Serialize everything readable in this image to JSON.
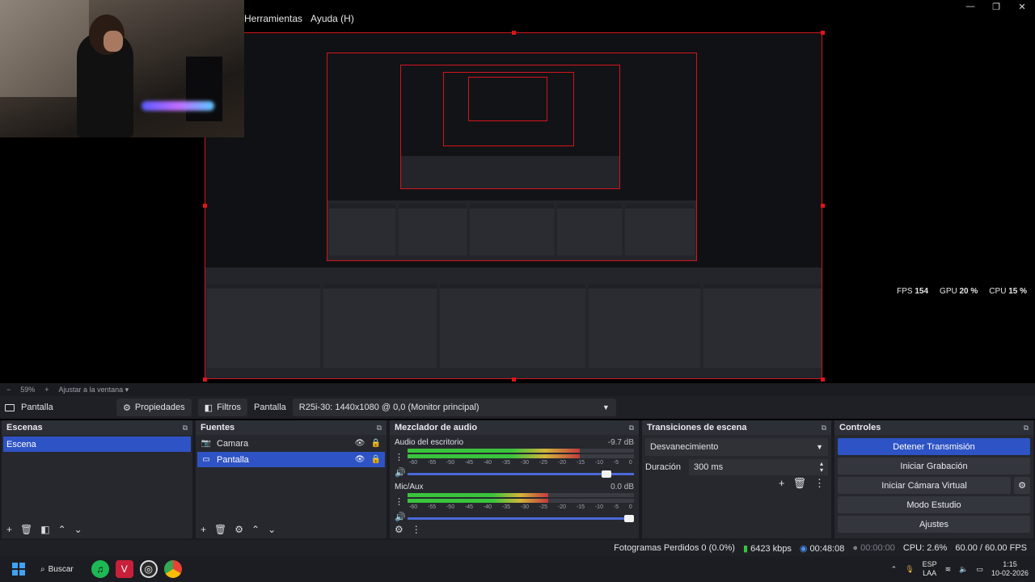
{
  "menu": {
    "tools": "Herramientas",
    "help": "Ayuda (H)"
  },
  "window_controls": [
    "—",
    "❐",
    "✕"
  ],
  "preview_stats": {
    "fps_label": "FPS",
    "fps_value": "154",
    "gpu_label": "GPU",
    "gpu_value": "20 %",
    "cpu_label": "CPU",
    "cpu_value": "15 %"
  },
  "zoom_bar": {
    "minus": "−",
    "zoom": "59%",
    "plus": "+",
    "fit": "Ajustar a la ventana"
  },
  "source_toolbar": {
    "source_name": "Pantalla",
    "properties": "Propiedades",
    "filters": "Filtros",
    "display_label": "Pantalla",
    "display_value": "R25i-30: 1440x1080 @ 0,0 (Monitor principal)"
  },
  "scenes": {
    "title": "Escenas",
    "items": [
      {
        "label": "Escena",
        "selected": true
      }
    ]
  },
  "sources": {
    "title": "Fuentes",
    "items": [
      {
        "label": "Camara",
        "icon": "camera-icon",
        "selected": false
      },
      {
        "label": "Pantalla",
        "icon": "monitor-icon",
        "selected": true
      }
    ]
  },
  "mixer": {
    "title": "Mezclador de audio",
    "tracks": [
      {
        "name": "Audio del escritorio",
        "db": "-9.7 dB",
        "level": 0.76,
        "volume": 0.9
      },
      {
        "name": "Mic/Aux",
        "db": "0.0 dB",
        "level": 0.62,
        "volume": 1.0
      }
    ],
    "ticks": [
      "-60",
      "-55",
      "-50",
      "-45",
      "-40",
      "-35",
      "-30",
      "-25",
      "-20",
      "-15",
      "-10",
      "-5",
      "0"
    ]
  },
  "transitions": {
    "title": "Transiciones de escena",
    "selected": "Desvanecimiento",
    "duration_label": "Duración",
    "duration_value": "300 ms"
  },
  "controls": {
    "title": "Controles",
    "stop_stream": "Detener Transmisión",
    "start_record": "Iniciar Grabación",
    "start_vcam": "Iniciar Cámara Virtual",
    "studio_mode": "Modo Estudio",
    "settings": "Ajustes"
  },
  "status_bar": {
    "dropped": "Fotogramas Perdidos 0 (0.0%)",
    "bitrate": "6423 kbps",
    "stream_time": "00:48:08",
    "record_time": "00:00:00",
    "cpu": "CPU: 2.6%",
    "fps": "60.00 / 60.00 FPS"
  },
  "taskbar": {
    "search": "Buscar",
    "lang_top": "ESP",
    "lang_bottom": "LAA",
    "time": "1:15",
    "date": "10-02-2026"
  },
  "colors": {
    "accent": "#2e53c4",
    "selection_border": "#d3141c",
    "meter_green": "#39c43c",
    "meter_yellow": "#d3b53a",
    "meter_red": "#c23b3b"
  }
}
